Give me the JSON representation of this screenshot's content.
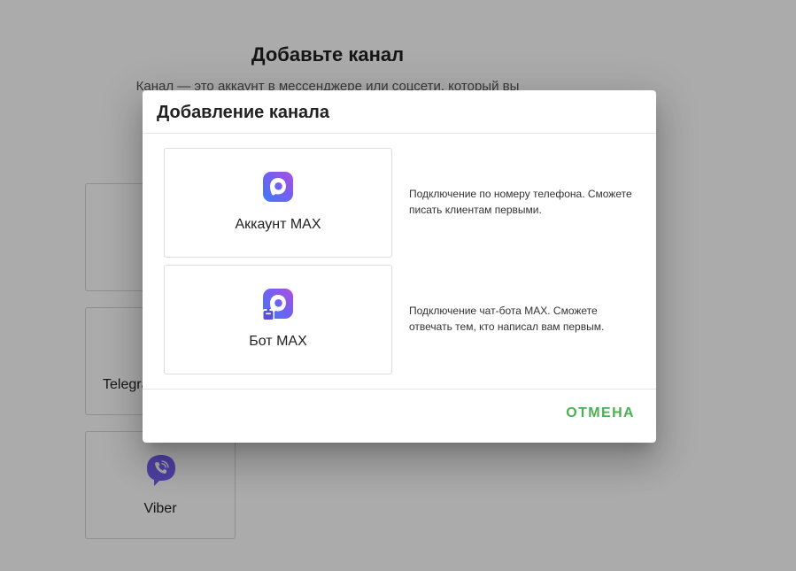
{
  "background": {
    "title": "Добавьте канал",
    "subtitle": "Канал — это аккаунт в мессенджере или соцсети, который вы",
    "cards": [
      {
        "label": "",
        "icon": "empty"
      },
      {
        "label": "Telegram",
        "icon": "telegram-icon"
      },
      {
        "label": "Viber",
        "icon": "viber-icon"
      }
    ]
  },
  "dialog": {
    "title": "Добавление канала",
    "options": [
      {
        "label": "Аккаунт MAX",
        "icon": "max-account-icon",
        "description": "Подключение по номеру телефона. Сможете писать клиентам первыми."
      },
      {
        "label": "Бот MAX",
        "icon": "max-bot-icon",
        "description": "Подключение чат-бота MAX. Сможете отвечать тем, кто написал вам первым."
      }
    ],
    "cancel_label": "ОТМЕНА"
  },
  "colors": {
    "accent_green": "#4caf50",
    "max_gradient_start": "#3d7bf7",
    "max_gradient_end": "#9b4de8",
    "viber_purple": "#7360f2"
  }
}
